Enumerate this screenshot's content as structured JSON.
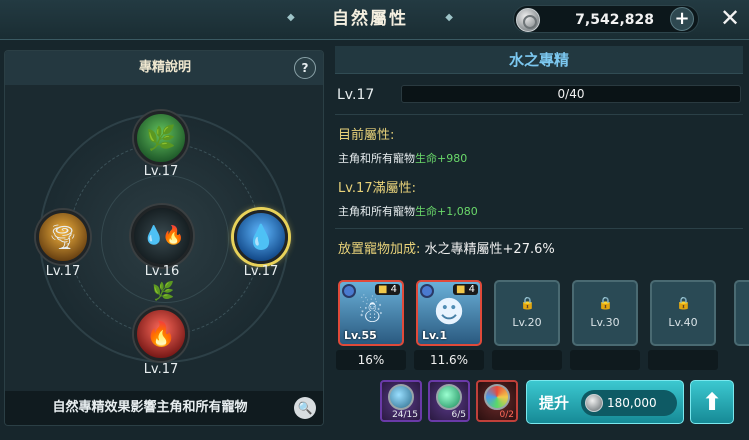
{
  "header": {
    "title": "自然屬性",
    "currency": "7,542,828",
    "plus_symbol": "+",
    "close_symbol": "✕"
  },
  "left_panel": {
    "title": "專精說明",
    "help_symbol": "?",
    "nodes": {
      "grass": {
        "level": "Lv.17",
        "icon": "grass-leaf-icon"
      },
      "wind": {
        "level": "Lv.17",
        "icon": "whirlwind-icon"
      },
      "center": {
        "level": "Lv.16",
        "icon": "nature-combined-icon"
      },
      "water": {
        "level": "Lv.17",
        "icon": "water-drop-icon"
      },
      "fire": {
        "level": "Lv.17",
        "icon": "fire-icon"
      }
    },
    "footer_text": "自然專精效果影響主角和所有寵物",
    "search_symbol": "🔍"
  },
  "detail": {
    "title": "水之專精",
    "level": "Lv.17",
    "progress": "0/40",
    "progress_fraction": 0,
    "current_title": "目前屬性:",
    "current_prefix": "主角和所有寵物",
    "current_stat": "生命+980",
    "max_title": "Lv.17滿屬性:",
    "max_prefix": "主角和所有寵物",
    "max_stat": "生命+1,080",
    "bonus_label": "放置寵物加成:",
    "bonus_value": "水之專精屬性+27.6%"
  },
  "slots": [
    {
      "type": "pet",
      "level": "Lv.55",
      "badge": "4",
      "pct": "16%"
    },
    {
      "type": "pet",
      "level": "Lv.1",
      "badge": "4",
      "pct": "11.6%"
    },
    {
      "type": "locked",
      "level": "Lv.20",
      "pct": ""
    },
    {
      "type": "locked",
      "level": "Lv.30",
      "pct": ""
    },
    {
      "type": "locked",
      "level": "Lv.40",
      "pct": ""
    }
  ],
  "stones": [
    {
      "count": "24/15"
    },
    {
      "count": "6/5"
    },
    {
      "count": "0/2"
    }
  ],
  "upgrade": {
    "label": "提升",
    "cost": "180,000",
    "arrow_symbol": "⬆"
  },
  "colors": {
    "accent": "#3cc8d0",
    "water": "#7cc8f0",
    "stat_green": "#6ad86a",
    "gold_text": "#e8d27a"
  }
}
